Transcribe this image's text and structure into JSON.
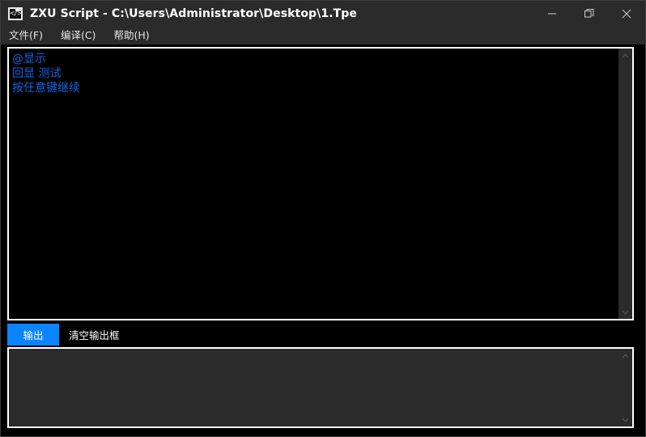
{
  "window": {
    "title": "ZXU Script - C:\\Users\\Administrator\\Desktop\\1.Tpe",
    "icon": "script-window-icon",
    "controls": {
      "minimize": "minimize-icon",
      "maximize": "restore-icon",
      "close": "close-icon"
    },
    "colors": {
      "titlebar_bg": "#2b2b2b",
      "accent": "#0a84ff",
      "editor_bg": "#000000",
      "code_text": "#1565e0",
      "panel_bg": "#2b2b2b",
      "border": "#ffffff"
    }
  },
  "menu": {
    "items": [
      {
        "label": "文件(F)",
        "name": "menu-file"
      },
      {
        "label": "编译(C)",
        "name": "menu-compile"
      },
      {
        "label": "帮助(H)",
        "name": "menu-help"
      }
    ]
  },
  "editor": {
    "lines": [
      "@显示",
      "回显 测试",
      "按任意键继续"
    ],
    "scrollbar": {
      "up": "▲",
      "down": "▼"
    }
  },
  "toolbar": {
    "output_tab_label": "输出",
    "clear_output_label": "清空输出框"
  },
  "output": {
    "text": "",
    "scrollbar": {
      "up": "▲",
      "down": "▼"
    }
  }
}
